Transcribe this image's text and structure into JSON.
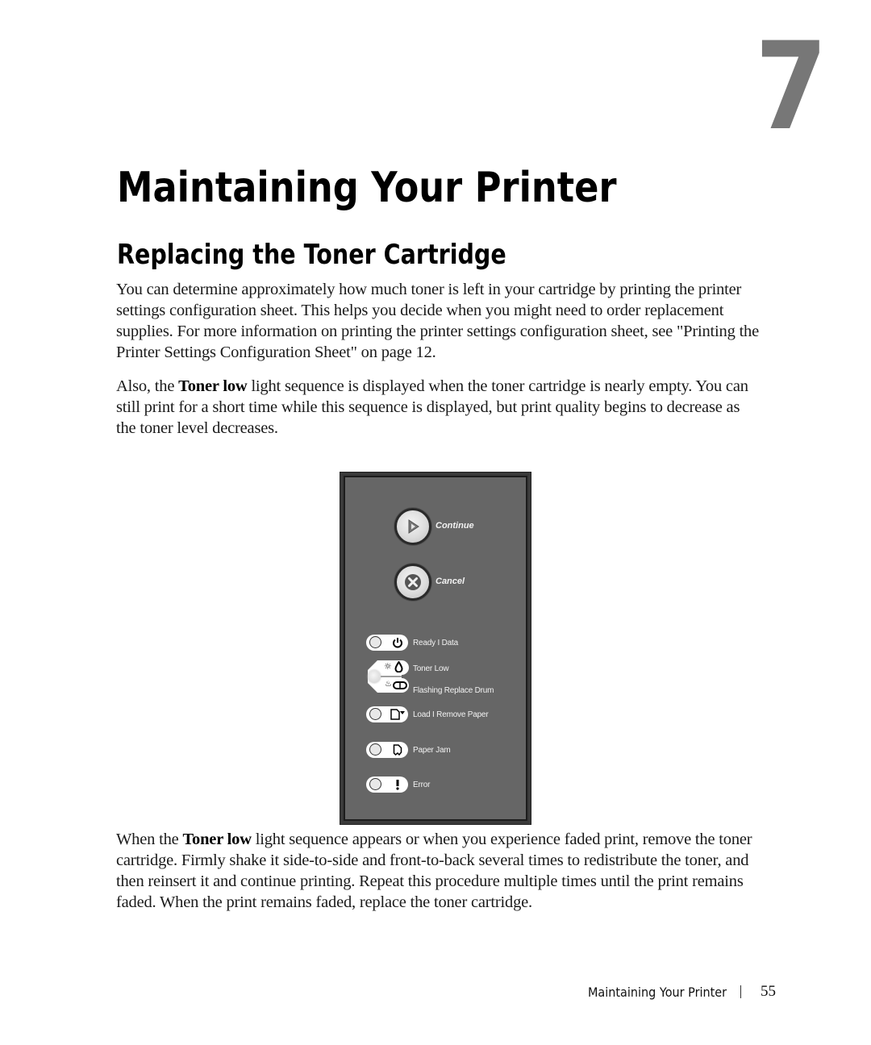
{
  "chapter": {
    "number": "7"
  },
  "page_title": "Maintaining Your Printer",
  "section_title": "Replacing the Toner Cartridge",
  "paragraphs": {
    "p1": "You can determine approximately how much toner is left in your cartridge by printing the printer settings configuration sheet. This helps you decide when you might need to order replacement supplies. For more information on printing the printer settings configuration sheet, see \"Printing the Printer Settings Configuration Sheet\" on page 12.",
    "p2_before": "Also, the ",
    "p2_bold": "Toner low",
    "p2_after": " light sequence is displayed when the toner cartridge is nearly empty. You can still print for a short time while this sequence is displayed, but print quality begins to decrease as the toner level decreases.",
    "p3_before": "When the ",
    "p3_bold": "Toner low",
    "p3_after": " light sequence appears or when you experience faded print, remove the toner cartridge. Firmly shake it side-to-side and front-to-back several times to redistribute the toner, and then reinsert it and continue printing.  Repeat this procedure multiple times until the print remains faded. When the print remains faded, replace the toner cartridge."
  },
  "control_panel": {
    "buttons": [
      {
        "label": "Continue",
        "icon": "play-icon"
      },
      {
        "label": "Cancel",
        "icon": "x-icon"
      }
    ],
    "lights": [
      {
        "label": "Ready I Data",
        "icon": "power-icon",
        "state": "off"
      },
      {
        "label": "Toner Low",
        "icon": "toner-drop-icon",
        "state": "on"
      },
      {
        "label": "Flashing Replace Drum",
        "icon": "drum-icon",
        "state": "on"
      },
      {
        "label": "Load I Remove Paper",
        "icon": "paper-load-icon",
        "state": "off"
      },
      {
        "label": "Paper Jam",
        "icon": "paper-jam-icon",
        "state": "off"
      },
      {
        "label": "Error",
        "icon": "exclamation-icon",
        "state": "off"
      }
    ],
    "colors": {
      "panel": "#666666",
      "frame": "#3a3a3a",
      "label": "#f2f2f2"
    }
  },
  "footer": {
    "title": "Maintaining Your Printer",
    "page_number": "55"
  }
}
